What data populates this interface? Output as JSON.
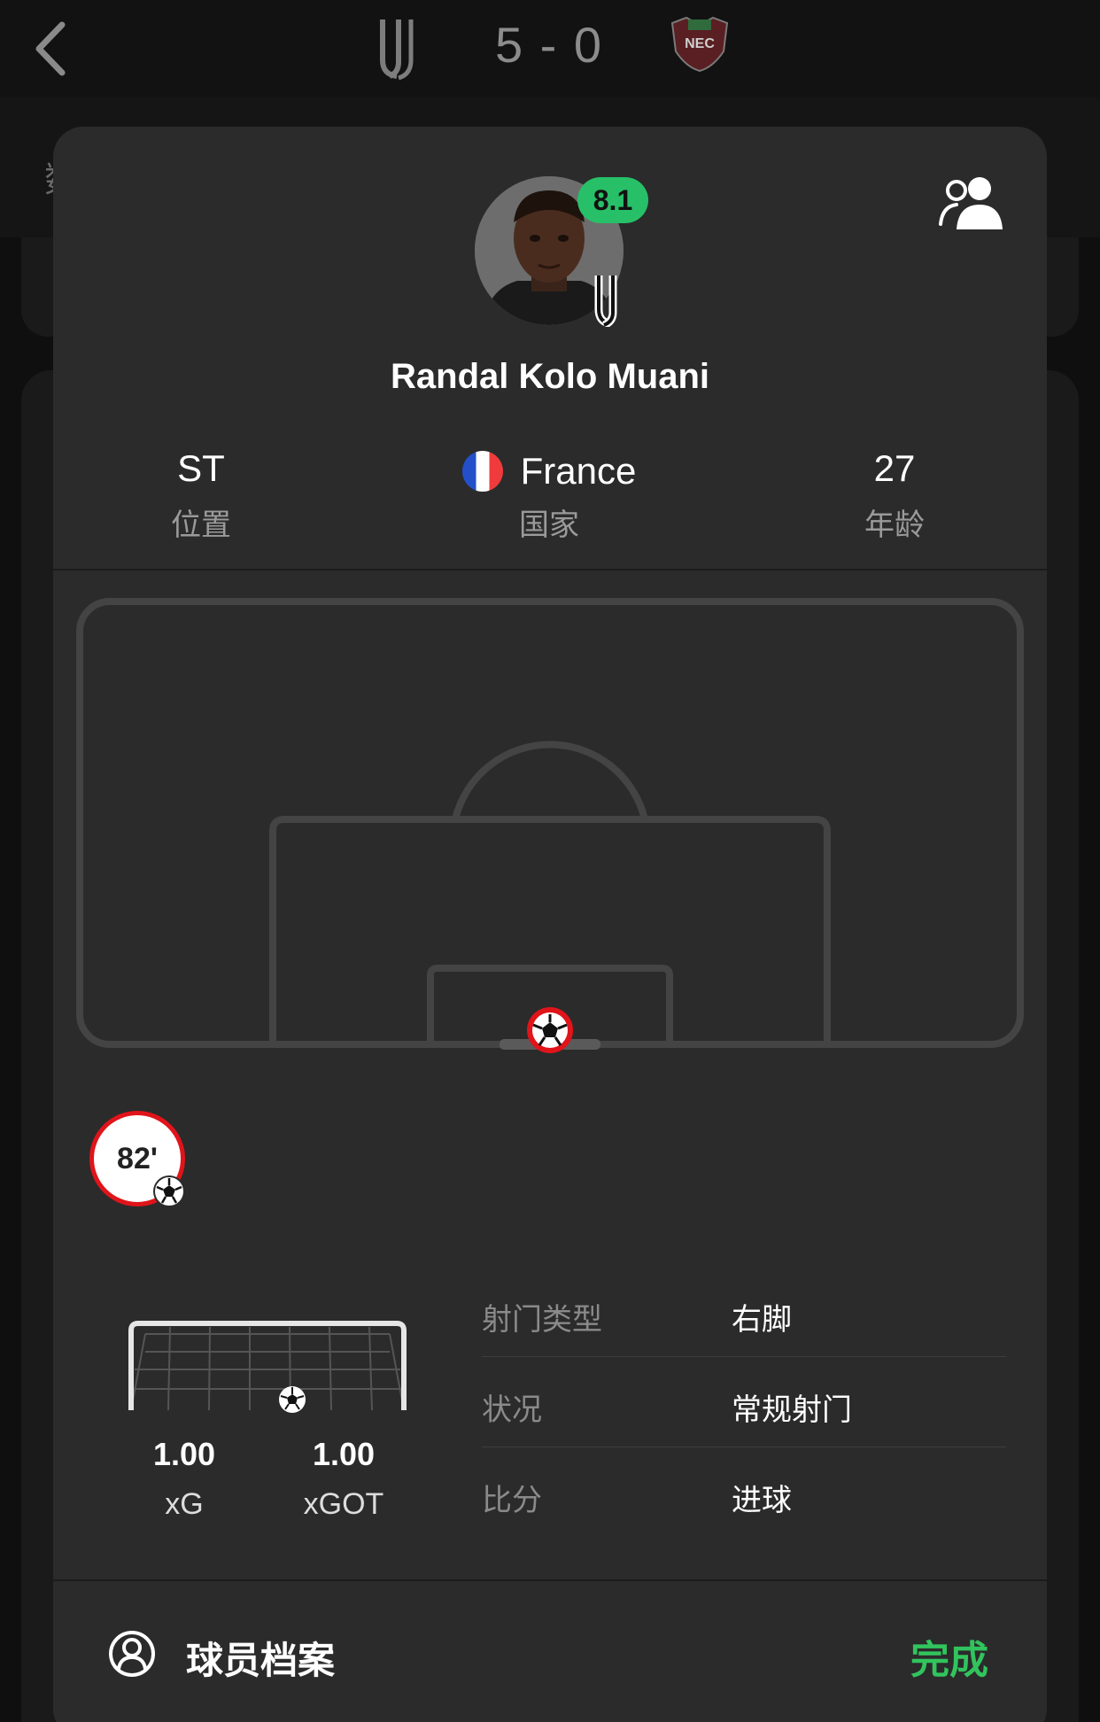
{
  "header": {
    "score": "5 - 0",
    "home_crest_icon": "juventus-crest-icon",
    "away_crest_icon": "nec-crest-icon",
    "away_crest_text": "NEC",
    "background_peek_text": "数"
  },
  "player": {
    "name": "Randal Kolo Muani",
    "rating": "8.1",
    "position_value": "ST",
    "position_label": "位置",
    "nation_value": "France",
    "nation_label": "国家",
    "age_value": "27",
    "age_label": "年龄"
  },
  "shot": {
    "minute": "82'",
    "xg_value": "1.00",
    "xg_label": "xG",
    "xgot_value": "1.00",
    "xgot_label": "xGOT",
    "details": [
      {
        "key": "射门类型",
        "value": "右脚"
      },
      {
        "key": "状况",
        "value": "常规射门"
      },
      {
        "key": "比分",
        "value": "进球"
      }
    ]
  },
  "footer": {
    "profile_label": "球员档案",
    "done_label": "完成"
  },
  "colors": {
    "rating_badge": "#27c068",
    "goal_marker": "#e0141a",
    "done": "#31c45d",
    "sheet": "#2b2b2b"
  }
}
